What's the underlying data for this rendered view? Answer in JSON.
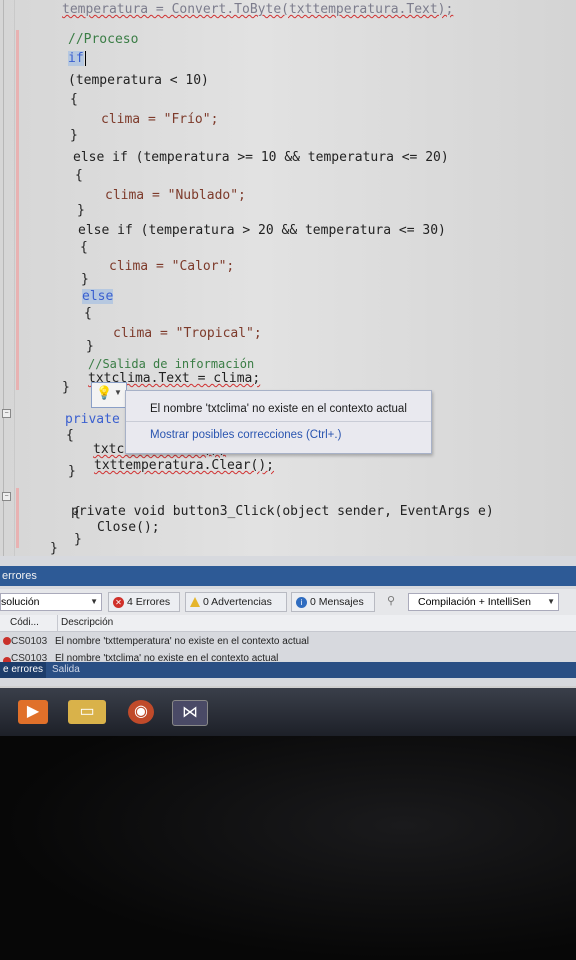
{
  "editor": {
    "lines": [
      {
        "id": "top",
        "text": "temperatura = Convert.ToByte(txttemperatura.Text);"
      },
      {
        "id": "cm-proceso",
        "text": "//Proceso"
      },
      {
        "id": "if",
        "text": "if"
      },
      {
        "id": "cond1",
        "text": "(temperatura < 10)"
      },
      {
        "id": "open1",
        "text": "{"
      },
      {
        "id": "asg1",
        "text": "clima = \"Frío\";"
      },
      {
        "id": "close1",
        "text": "}"
      },
      {
        "id": "elseif1",
        "text": "else if (temperatura >= 10 && temperatura <= 20)"
      },
      {
        "id": "open2",
        "text": "{"
      },
      {
        "id": "asg2",
        "text": "clima = \"Nublado\";"
      },
      {
        "id": "close2",
        "text": "}"
      },
      {
        "id": "elseif2",
        "text": "else if (temperatura > 20 && temperatura <= 30)"
      },
      {
        "id": "open3",
        "text": "{"
      },
      {
        "id": "asg3",
        "text": "clima = \"Calor\";"
      },
      {
        "id": "close3",
        "text": "}"
      },
      {
        "id": "else",
        "text": "else"
      },
      {
        "id": "open4",
        "text": "{"
      },
      {
        "id": "asg4",
        "text": "clima = \"Tropical\";"
      },
      {
        "id": "close4",
        "text": "}"
      },
      {
        "id": "cm-salida",
        "text": "//Salida de información"
      },
      {
        "id": "out",
        "text": "txtclima.Text = clima;"
      },
      {
        "id": "endmethod",
        "text": "}"
      },
      {
        "id": "priv1",
        "text": "private voi"
      },
      {
        "id": "open5",
        "text": "{"
      },
      {
        "id": "clr1",
        "text": "txtclima.Clear();"
      },
      {
        "id": "clr2",
        "text": "txttemperatura.Clear();"
      },
      {
        "id": "close5",
        "text": "}"
      },
      {
        "id": "priv2",
        "text": "private void button3_Click(object sender, EventArgs e)"
      },
      {
        "id": "open6",
        "text": "{"
      },
      {
        "id": "closecall",
        "text": "Close();"
      },
      {
        "id": "close6",
        "text": "}"
      },
      {
        "id": "close7",
        "text": "}"
      }
    ]
  },
  "quickinfo": {
    "message": "El nombre 'txtclima' no existe en el contexto actual",
    "fix_link": "Mostrar posibles correcciones (Ctrl+.)"
  },
  "errorlist": {
    "title": "errores",
    "scope": "solución",
    "errors_btn": "4 Errores",
    "warnings_btn": "0 Advertencias",
    "messages_btn": "0 Mensajes",
    "build_filter": "Compilación + IntelliSen",
    "col_code": "Códi...",
    "col_desc": "Descripción",
    "rows": [
      {
        "code": "CS0103",
        "desc": "El nombre 'txttemperatura' no existe en el contexto actual"
      },
      {
        "code": "CS0103",
        "desc": "El nombre 'txtclima' no existe en el contexto actual"
      }
    ],
    "tab_errors": "e errores",
    "tab_output": "Salida"
  },
  "taskbar": {
    "icons": [
      "media-player-icon",
      "file-explorer-icon",
      "firefox-icon",
      "visual-studio-icon"
    ]
  }
}
